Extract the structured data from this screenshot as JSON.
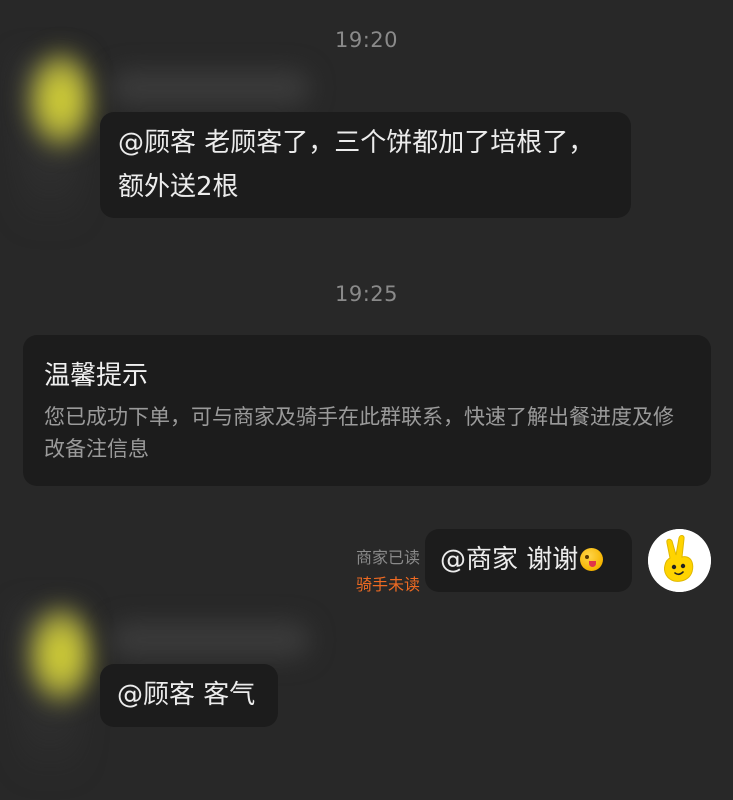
{
  "timestamps": [
    "19:20",
    "19:25"
  ],
  "messages": {
    "merchant_1": "@顾客 老顾客了，三个饼都加了培根了，额外送2根",
    "merchant_2": "@顾客 客气",
    "customer_1": "@商家 谢谢"
  },
  "notice": {
    "title": "温馨提示",
    "body": "您已成功下单，可与商家及骑手在此群联系，快速了解出餐进度及修改备注信息"
  },
  "read_status": {
    "merchant": "商家已读",
    "rider": "骑手未读"
  },
  "colors": {
    "background": "#282828",
    "bubble": "#1c1c1c",
    "rider_unread": "#ee6a22",
    "avatar_yellow": "#ffd400"
  },
  "icons": {
    "emoji": "winking-tongue-emoji",
    "my_avatar": "yellow-hand-mascot"
  }
}
